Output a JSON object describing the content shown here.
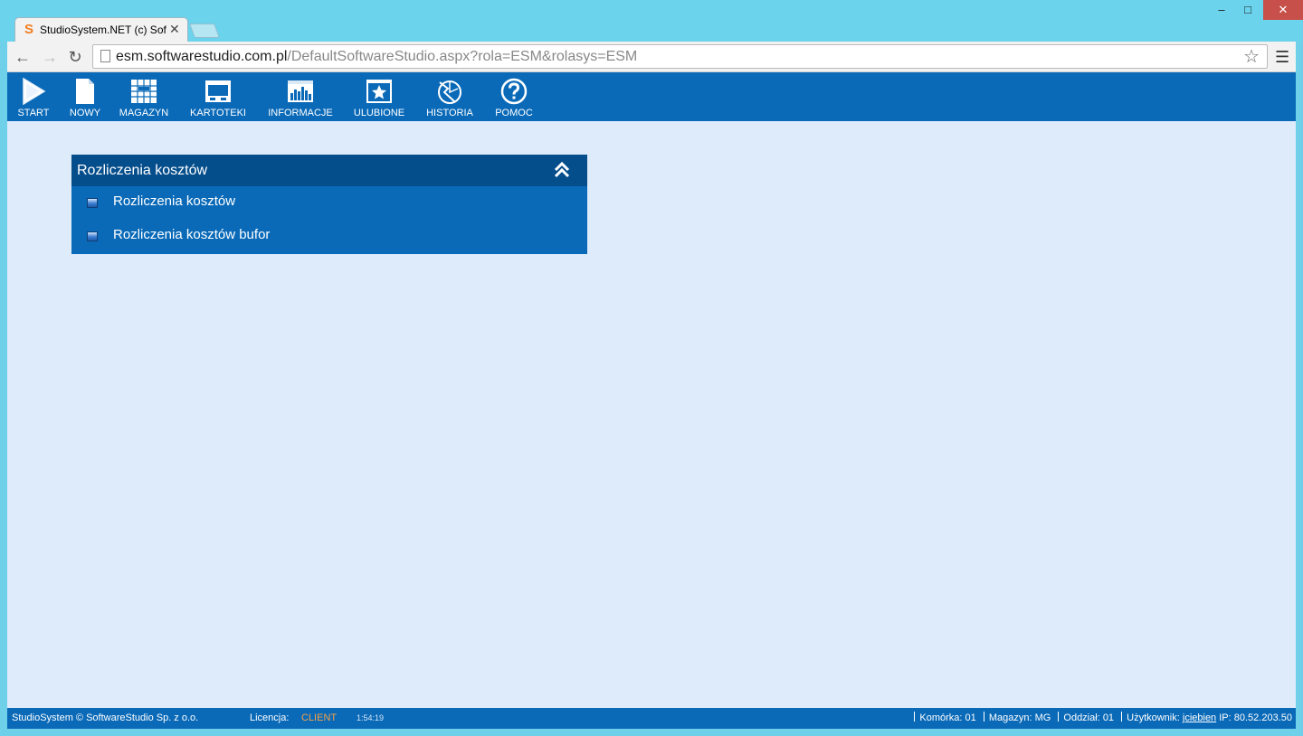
{
  "browser": {
    "tab_title": "StudioSystem.NET (c) Soft",
    "tab_favicon": "S",
    "url_host": "esm.softwarestudio.com.pl",
    "url_path": "/DefaultSoftwareStudio.aspx?rola=ESM&rolasys=ESM"
  },
  "nav": [
    {
      "label": "START",
      "icon": "play-icon"
    },
    {
      "label": "NOWY",
      "icon": "new-document-icon"
    },
    {
      "label": "MAGAZYN",
      "icon": "warehouse-grid-icon"
    },
    {
      "label": "KARTOTEKI",
      "icon": "window-card-icon"
    },
    {
      "label": "INFORMACJE",
      "icon": "bar-chart-icon"
    },
    {
      "label": "ULUBIONE",
      "icon": "star-icon"
    },
    {
      "label": "HISTORIA",
      "icon": "history-icon"
    },
    {
      "label": "POMOC",
      "icon": "help-icon"
    }
  ],
  "panel": {
    "title": "Rozliczenia kosztów",
    "items": [
      {
        "label": "Rozliczenia kosztów"
      },
      {
        "label": "Rozliczenia kosztów bufor"
      }
    ]
  },
  "status": {
    "copyright": "StudioSystem © SoftwareStudio Sp. z o.o.",
    "license_label": "Licencja:",
    "license_value": "CLIENT",
    "time": "1:54:19",
    "cell_label": "Komórka:",
    "cell_value": "01",
    "warehouse_label": "Magazyn:",
    "warehouse_value": "MG",
    "branch_label": "Oddział:",
    "branch_value": "01",
    "user_label": "Użytkownik:",
    "user_value": "jciebien",
    "ip_label": "IP:",
    "ip_value": "80.52.203.50"
  },
  "colors": {
    "appbar": "#0a6ab8",
    "panel_header": "#054e8c",
    "background": "#deebfb",
    "license_accent": "#f5a145"
  }
}
